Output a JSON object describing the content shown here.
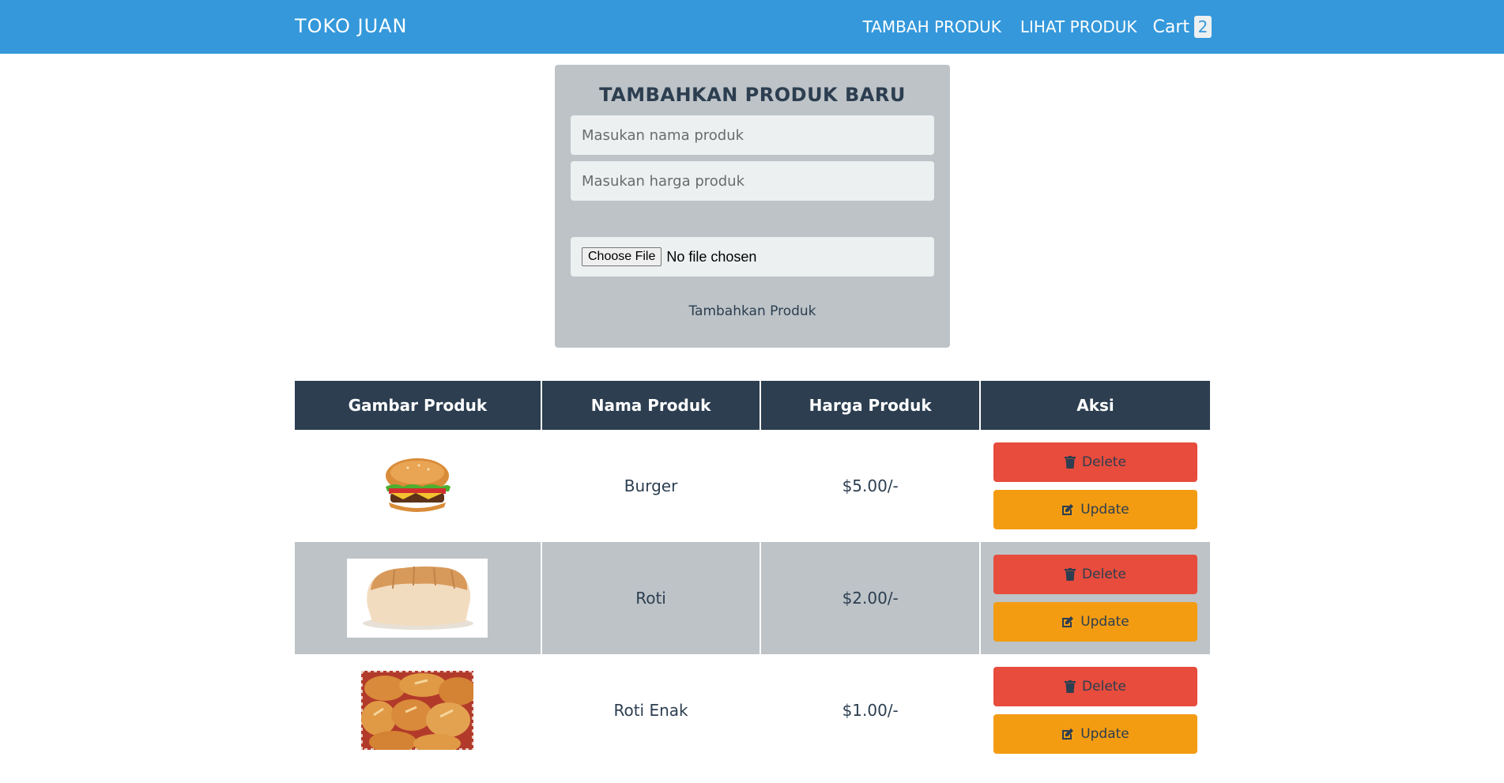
{
  "header": {
    "brand": "TOKO JUAN",
    "nav": {
      "add_product": "TAMBAH PRODUK",
      "view_product": "LIHAT PRODUK",
      "cart_label": "Cart",
      "cart_count": "2"
    }
  },
  "form": {
    "title": "TAMBAHKAN PRODUK BARU",
    "name_placeholder": "Masukan nama produk",
    "price_placeholder": "Masukan harga produk",
    "file_button": "Choose File",
    "file_status": "No file chosen",
    "submit_label": "Tambahkan Produk"
  },
  "table": {
    "headers": [
      "Gambar Produk",
      "Nama Produk",
      "Harga Produk",
      "Aksi"
    ],
    "rows": [
      {
        "image": "burger-image",
        "name": "Burger",
        "price": "$5.00/-"
      },
      {
        "image": "bread-loaf-image",
        "name": "Roti",
        "price": "$2.00/-"
      },
      {
        "image": "bread-rolls-image",
        "name": "Roti Enak",
        "price": "$1.00/-"
      }
    ],
    "delete_label": "Delete",
    "update_label": "Update"
  },
  "colors": {
    "header_bg": "#3498db",
    "table_header_bg": "#2c3e50",
    "card_bg": "#bdc3c7",
    "delete_btn": "#e74c3c",
    "update_btn": "#f39c12"
  },
  "icons": {
    "delete": "trash-icon",
    "update": "edit-icon"
  }
}
